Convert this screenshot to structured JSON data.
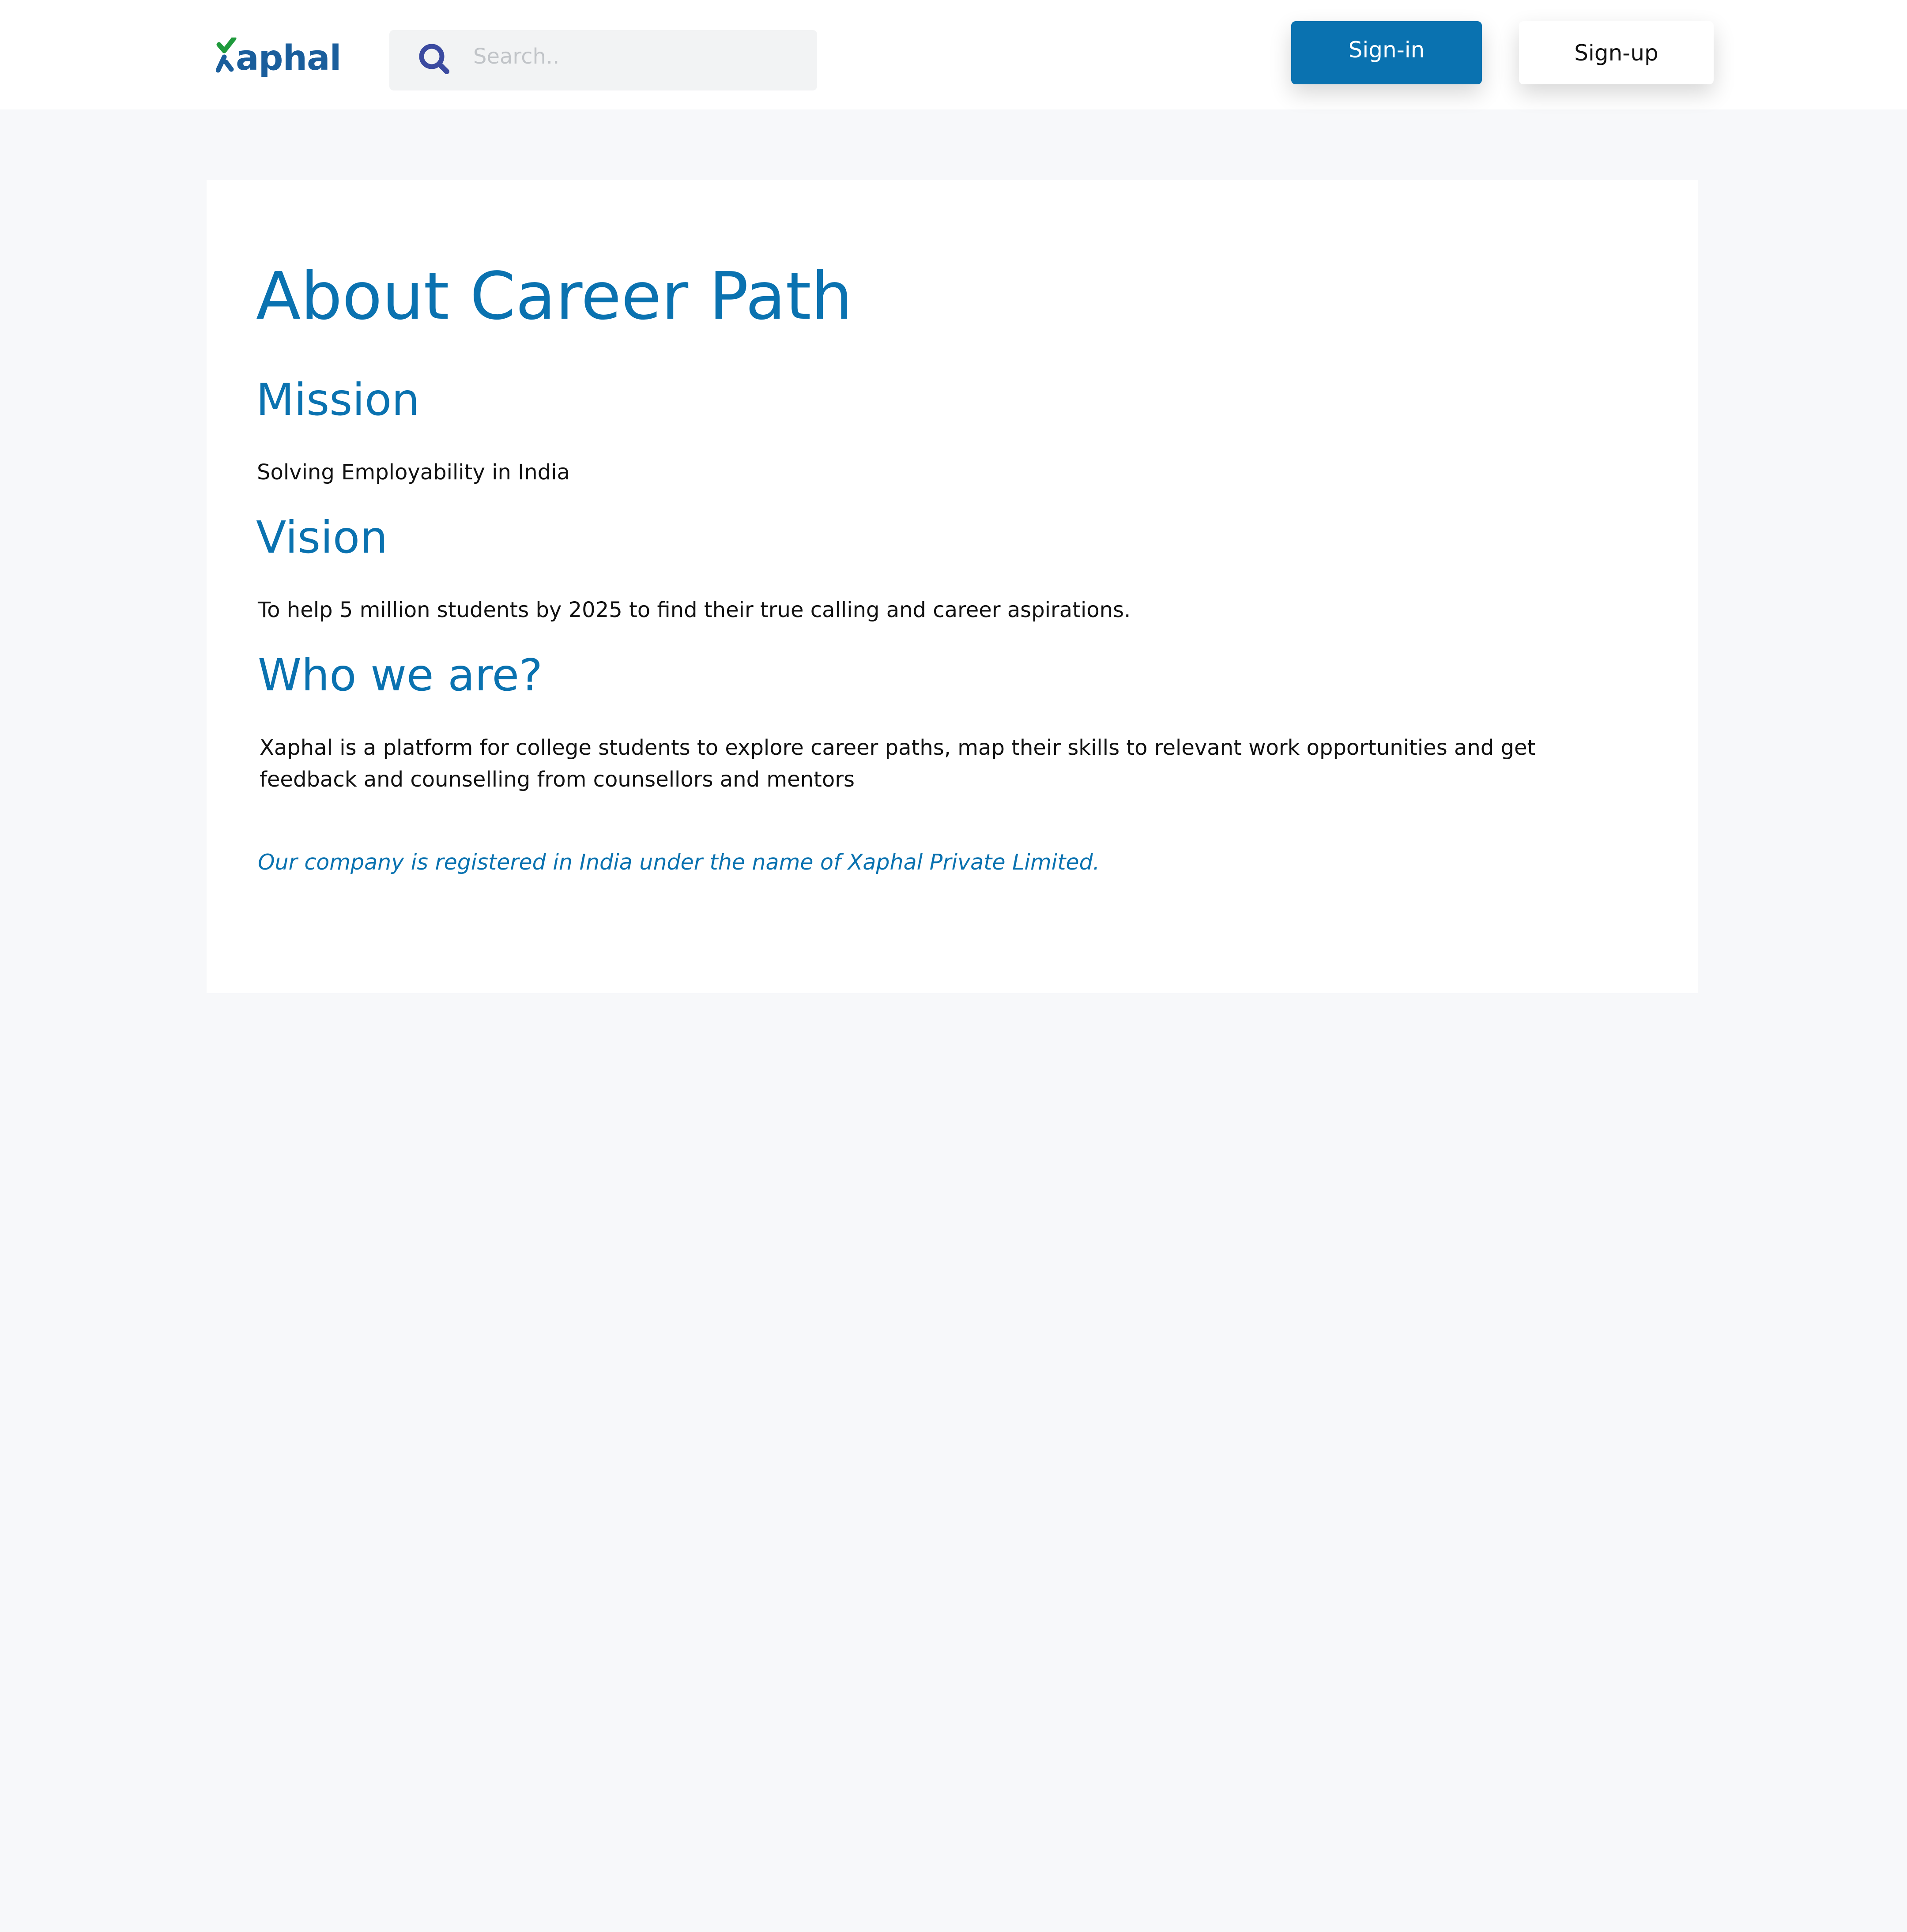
{
  "header": {
    "logo_text": "aphal",
    "logo_word": "Xaphal",
    "search_placeholder": "Search..",
    "signin_label": "Sign-in",
    "signup_label": "Sign-up"
  },
  "about": {
    "title": "About Career Path",
    "sections": [
      {
        "heading": "Mission",
        "text": "Solving Employability in India"
      },
      {
        "heading": "Vision",
        "text": "To help 5 million students by 2025 to find their true calling and career aspirations."
      },
      {
        "heading": "Who we are?",
        "text": "Xaphal is a platform for college students to explore career paths, map their skills to relevant work opportunities and get feedback and counselling from counsellors and mentors"
      }
    ],
    "footnote": "Our company is registered in India under the name of Xaphal Private Limited."
  },
  "colors": {
    "brand_blue": "#0a72b0",
    "logo_green": "#1f9a3c",
    "page_background": "#f7f8fa",
    "search_icon": "#3b4aa0"
  },
  "icons": {
    "search": "search-icon",
    "logo_mark": "x-check-icon"
  }
}
